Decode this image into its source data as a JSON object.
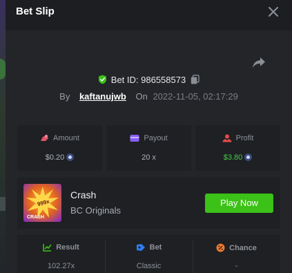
{
  "header": {
    "title": "Bet Slip",
    "close_icon": "close-icon"
  },
  "bet": {
    "id_label": "Bet ID: 986558573",
    "by_label": "By",
    "username": "kaftanujwb",
    "on_label": "On",
    "datetime": "2022-11-05, 02:17:29"
  },
  "stats": [
    {
      "label": "Amount",
      "value": "$0.20",
      "icon": "amount-icon",
      "color": "#e0566b"
    },
    {
      "label": "Payout",
      "value": "20 x",
      "icon": "payout-wallet-icon",
      "color": "#8a5cf6"
    },
    {
      "label": "Profit",
      "value": "$3.80",
      "icon": "profit-icon",
      "color": "#e84a4a"
    }
  ],
  "game": {
    "name": "Crash",
    "provider": "BC Originals",
    "play_label": "Play Now",
    "thumb_text": "CRASH",
    "thumb_badge": "999x"
  },
  "details": [
    {
      "label": "Result",
      "value": "102.27x",
      "icon": "result-chart-icon",
      "color": "#3bc117"
    },
    {
      "label": "Bet",
      "value": "Classic",
      "icon": "bet-tag-icon",
      "color": "#2f7bf0"
    },
    {
      "label": "Chance",
      "value": "-",
      "icon": "chance-percent-icon",
      "color": "#f07a2f"
    }
  ],
  "colors": {
    "accent_green": "#3bc117",
    "panel_bg": "#232528",
    "card_bg": "#1e2023"
  }
}
